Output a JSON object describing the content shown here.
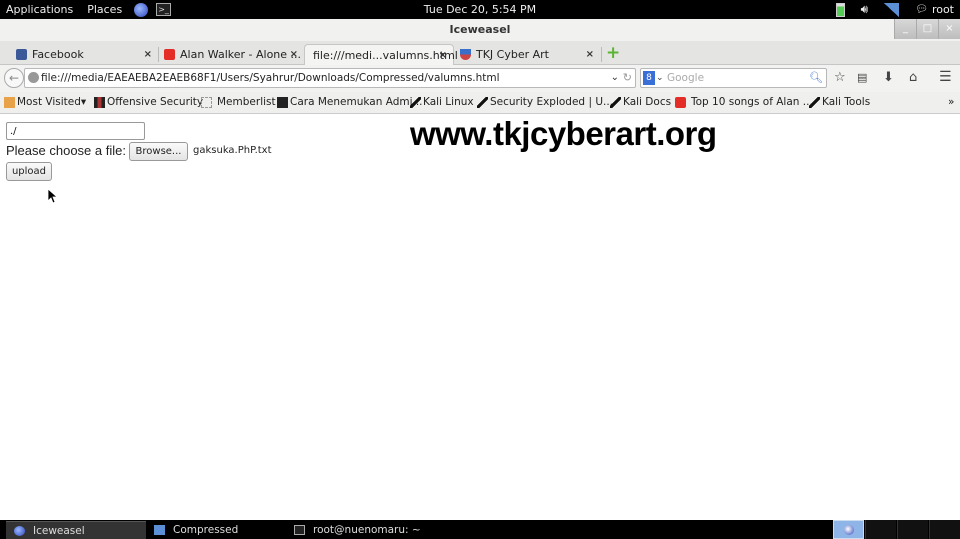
{
  "top_panel": {
    "applications": "Applications",
    "places": "Places",
    "clock": "Tue Dec 20,  5:54 PM",
    "user": "root",
    "icons": [
      "iceweasel-launcher-icon",
      "terminal-icon",
      "battery-icon",
      "volume-icon",
      "signal-icon",
      "chat-icon"
    ]
  },
  "window": {
    "title": "Iceweasel",
    "controls": {
      "minimize": "_",
      "maximize": "□",
      "close": "×"
    }
  },
  "tabs": [
    {
      "label": "Facebook",
      "icon": "facebook-icon",
      "active": false
    },
    {
      "label": "Alan Walker - Alone ...",
      "icon": "youtube-icon",
      "active": false
    },
    {
      "label": "file:///medi...valumns.html",
      "icon": "",
      "active": true
    },
    {
      "label": "TKJ Cyber Art",
      "icon": "tkj-icon",
      "active": false
    }
  ],
  "tab_close": "×",
  "new_tab": "+",
  "navbar": {
    "url": "file:///media/EAEAEBA2EAEB68F1/Users/Syahrur/Downloads/Compressed/valumns.html",
    "search_placeholder": "Google",
    "search_engine": "8"
  },
  "bookmarks": [
    {
      "label": "Most Visited",
      "icon": "folder-icon",
      "dropdown": "▾"
    },
    {
      "label": "Offensive Security",
      "icon": "offsec-icon"
    },
    {
      "label": "Memberlist",
      "icon": "page-icon"
    },
    {
      "label": "Cara Menemukan Admi...",
      "icon": "terminal-icon"
    },
    {
      "label": "Kali Linux",
      "icon": "kali-icon"
    },
    {
      "label": "Security Exploded | U...",
      "icon": "kali-icon"
    },
    {
      "label": "Kali Docs",
      "icon": "kali-icon"
    },
    {
      "label": "Top 10 songs of Alan ...",
      "icon": "youtube-icon"
    },
    {
      "label": "Kali Tools",
      "icon": "kali-icon"
    }
  ],
  "bookmarks_overflow": "»",
  "page": {
    "path_value": "./",
    "choose_label": "Please choose a file:",
    "browse_label": "Browse...",
    "file_name": "gaksuka.PhP.txt",
    "upload_label": "upload",
    "watermark": "www.tkjcyberart.org"
  },
  "taskbar": {
    "items": [
      {
        "label": "Iceweasel",
        "active": true
      },
      {
        "label": "Compressed",
        "active": false
      },
      {
        "label": "root@nuenomaru: ~",
        "active": false
      }
    ]
  }
}
